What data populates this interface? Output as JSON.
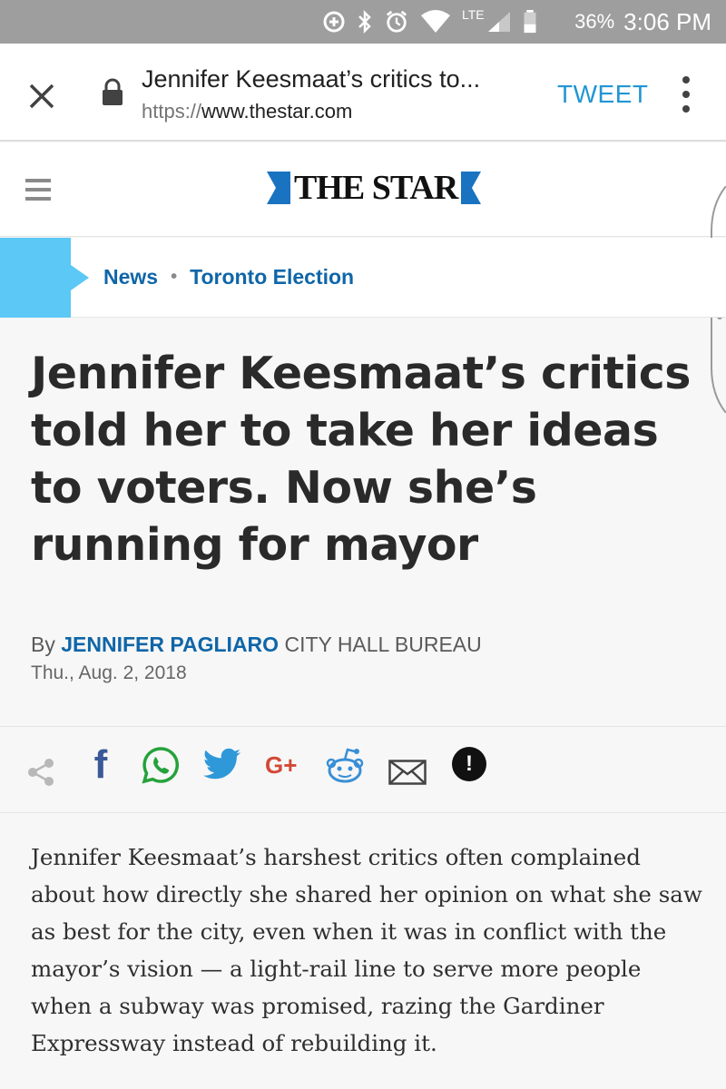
{
  "status_bar": {
    "network": "LTE",
    "battery_percent": "36%",
    "time": "3:06 PM",
    "icons": [
      "data-saver-icon",
      "bluetooth-icon",
      "alarm-icon",
      "wifi-icon",
      "signal-icon",
      "battery-icon"
    ]
  },
  "toolbar": {
    "title": "Jennifer Keesmaat’s critics to...",
    "url_scheme": "https://",
    "url_host": "www.thestar.com",
    "tweet_label": "TWEET",
    "icons": [
      "close-icon",
      "lock-icon",
      "overflow-menu-icon"
    ]
  },
  "site_header": {
    "logo_text": "THE STAR",
    "brand_color": "#1a73c0"
  },
  "breadcrumb": {
    "items": [
      "News",
      "Toronto Election"
    ],
    "accent_color": "#5bc8f5"
  },
  "article": {
    "headline": "Jennifer Keesmaat’s critics told her to take her ideas to voters. Now she’s running for mayor",
    "by_prefix": "By",
    "author": "JENNIFER PAGLIARO",
    "desk": "CITY HALL BUREAU",
    "date": "Thu., Aug. 2, 2018",
    "body": "Jennifer Keesmaat’s harshest critics often complained about how directly she shared her opinion on what she saw as best for the city, even when it was in conflict with the mayor’s vision — a light-rail line to serve more people when a subway was promised, razing the Gardiner Expressway instead of rebuilding it."
  },
  "share": {
    "facebook_glyph": "f",
    "google_plus_glyph": "G+",
    "report_glyph": "!",
    "icons": [
      "share-icon",
      "facebook-icon",
      "whatsapp-icon",
      "twitter-icon",
      "google-plus-icon",
      "reddit-icon",
      "email-icon",
      "report-icon"
    ]
  }
}
